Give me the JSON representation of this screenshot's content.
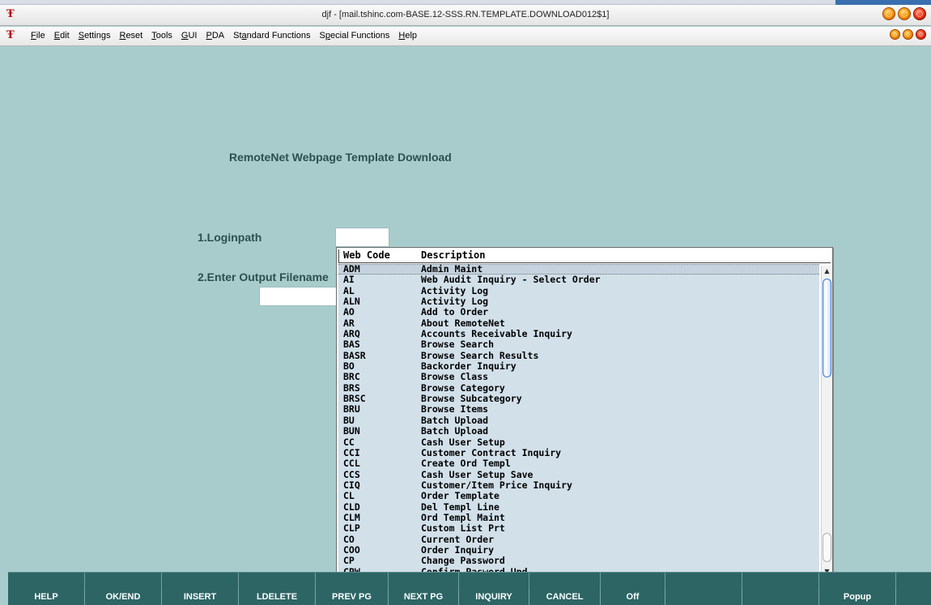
{
  "window": {
    "title": "djf - [mail.tshinc.com-BASE.12-SSS.RN.TEMPLATE.DOWNLOAD012$1]",
    "app_icon_glyph": "Ŧ"
  },
  "menubar": {
    "items": [
      {
        "pre": "",
        "u": "F",
        "post": "ile"
      },
      {
        "pre": "",
        "u": "E",
        "post": "dit"
      },
      {
        "pre": "",
        "u": "S",
        "post": "ettings"
      },
      {
        "pre": "",
        "u": "R",
        "post": "eset"
      },
      {
        "pre": "",
        "u": "T",
        "post": "ools"
      },
      {
        "pre": "",
        "u": "G",
        "post": "UI"
      },
      {
        "pre": "",
        "u": "P",
        "post": "DA"
      },
      {
        "pre": "St",
        "u": "a",
        "post": "ndard Functions"
      },
      {
        "pre": "S",
        "u": "p",
        "post": "ecial Functions"
      },
      {
        "pre": "",
        "u": "H",
        "post": "elp"
      }
    ]
  },
  "screen": {
    "title": "RemoteNet Webpage Template Download",
    "field1_label": "1.Loginpath",
    "field2_label": "2.Enter Output Filename",
    "field1_value": "",
    "field2_value": ""
  },
  "popup": {
    "col1": "Web Code",
    "col2": "Description",
    "selected_index": 0,
    "rows": [
      {
        "code": "ADM",
        "desc": "Admin Maint"
      },
      {
        "code": "AI",
        "desc": "Web Audit Inquiry - Select Order"
      },
      {
        "code": "AL",
        "desc": "Activity Log"
      },
      {
        "code": "ALN",
        "desc": "Activity Log"
      },
      {
        "code": "AO",
        "desc": "Add to Order"
      },
      {
        "code": "AR",
        "desc": "About RemoteNet"
      },
      {
        "code": "ARQ",
        "desc": "Accounts Receivable Inquiry"
      },
      {
        "code": "BAS",
        "desc": "Browse Search"
      },
      {
        "code": "BASR",
        "desc": "Browse Search Results"
      },
      {
        "code": "BO",
        "desc": "Backorder Inquiry"
      },
      {
        "code": "BRC",
        "desc": "Browse Class"
      },
      {
        "code": "BRS",
        "desc": "Browse Category"
      },
      {
        "code": "BRSC",
        "desc": "Browse Subcategory"
      },
      {
        "code": "BRU",
        "desc": "Browse Items"
      },
      {
        "code": "BU",
        "desc": "Batch Upload"
      },
      {
        "code": "BUN",
        "desc": "Batch Upload"
      },
      {
        "code": "CC",
        "desc": "Cash User Setup"
      },
      {
        "code": "CCI",
        "desc": "Customer Contract Inquiry"
      },
      {
        "code": "CCL",
        "desc": "Create Ord Templ"
      },
      {
        "code": "CCS",
        "desc": "Cash User Setup Save"
      },
      {
        "code": "CIQ",
        "desc": "Customer/Item Price Inquiry"
      },
      {
        "code": "CL",
        "desc": "Order Template"
      },
      {
        "code": "CLD",
        "desc": "Del Templ Line"
      },
      {
        "code": "CLM",
        "desc": "Ord Templ Maint"
      },
      {
        "code": "CLP",
        "desc": "Custom List Prt"
      },
      {
        "code": "CO",
        "desc": "Current Order"
      },
      {
        "code": "COO",
        "desc": "Order Inquiry"
      },
      {
        "code": "CP",
        "desc": "Change Password"
      },
      {
        "code": "CPW",
        "desc": "Confirm Pasword Upd"
      }
    ]
  },
  "fkeys": [
    "HELP",
    "OK/END",
    "INSERT",
    "LDELETE",
    "PREV PG",
    "NEXT PG",
    "INQUIRY",
    "CANCEL",
    "Off",
    "",
    "",
    "Popup"
  ],
  "colors": {
    "background": "#a8cccc",
    "label_text": "#2d4f4f",
    "fkey_bar": "#2d6565",
    "list_background": "#d2e0ea"
  }
}
